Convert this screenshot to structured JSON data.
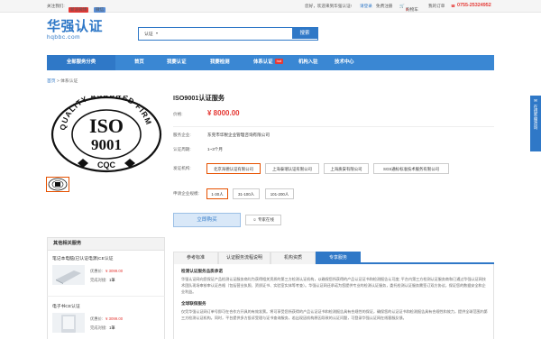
{
  "topbar": {
    "follow_label": "关注我们:",
    "weibo": "新浪微博",
    "wechat": "微信",
    "greeting": "您好，欢迎来到华强认证!",
    "login": "请登录",
    "register": "免费注册",
    "cart": "购物车",
    "cart_count": "0",
    "order": "我的订单",
    "phone": "0755-25324952",
    "colors": {
      "weibo": "#e53935",
      "wechat": "#5b8fd6",
      "phone": "#e53935"
    }
  },
  "logo": {
    "main": "华强认证",
    "sub": "hqbbc.com"
  },
  "search": {
    "category": "认证",
    "button": "搜索"
  },
  "nav": {
    "all": "全部服务分类",
    "items": [
      "首页",
      "我要认证",
      "我要检测",
      "体系认证",
      "机构入驻",
      "技术中心"
    ],
    "hot_badge": "hot"
  },
  "breadcrumb": {
    "home": "首页",
    "sep": ">",
    "current": "体系认证"
  },
  "product": {
    "title": "ISO9001认证服务",
    "price_label": "价格:",
    "price": "¥ 8000.00",
    "company_label": "服务企业:",
    "company": "东莞市华税企业管理咨询有限公司",
    "cycle_label": "认证周期:",
    "cycle": "1~3个月",
    "issuer_label": "发证机构:",
    "issuers": [
      "北京海德认证有限公司",
      "上海泰瑞认证有限公司",
      "上海质安有限公司",
      "SGS通标标准技术服务有限公司"
    ],
    "scale_label": "申请企业规模:",
    "scales": [
      "1-30人",
      "31-100人",
      "101-200人"
    ],
    "buy": "立即购买",
    "consult": "专家在线",
    "cert_text": {
      "ring": "QUALITY ASSURED FIRM",
      "iso": "ISO",
      "num": "9001",
      "cqc": "CQC"
    }
  },
  "sidebar": {
    "title": "其他相关服务",
    "items": [
      {
        "name": "笔记本电脑(已认证电源)CE认证",
        "price_label": "优惠价:",
        "price": "¥ 3099.00",
        "deals_label": "完成对接:",
        "deals": "1筆"
      },
      {
        "name": "电子书CE认证",
        "price_label": "优惠价:",
        "price": "¥ 3099.00",
        "deals_label": "完成对接:",
        "deals": "1筆"
      }
    ]
  },
  "tabs": [
    "参考标准",
    "认证服务流程说明",
    "机构资质",
    "专享服务"
  ],
  "content": {
    "h1": "检测认证服务品质承诺",
    "p1": "华强认证网向您保证产品检测认证服务商均为获得相关资质的第三方检测认证机构，以确保您所获得的产品认证证书和检测报告认可度; 平台内第三方检测认证服务商和已通过华强认证网技术团队现场审核审认证合格（包括营业执照、资质证书、实验室实体等考查）。华强认证网还承诺为您提供专业的检测认证服务，委托检测认证服务需签订双方协议，保证您的数据安全和企业利益。",
    "h2": "全球联保服务",
    "p2": "仅凭华强认证网订单号即可在合作方开具的有效发票。将可享受您所获得的产品认证证书和检测报告具有合规性的保证，确保您的认证证书和检测报告具有合规性和效力，提供全球范围内第三方检测认证机构。同时，平台提供多方投诉受理与证书查询服务，若出现因机构原因导致的认证问题，可登录华强认证网在线客服反馈。"
  },
  "float_tab": "在线客服咨询"
}
